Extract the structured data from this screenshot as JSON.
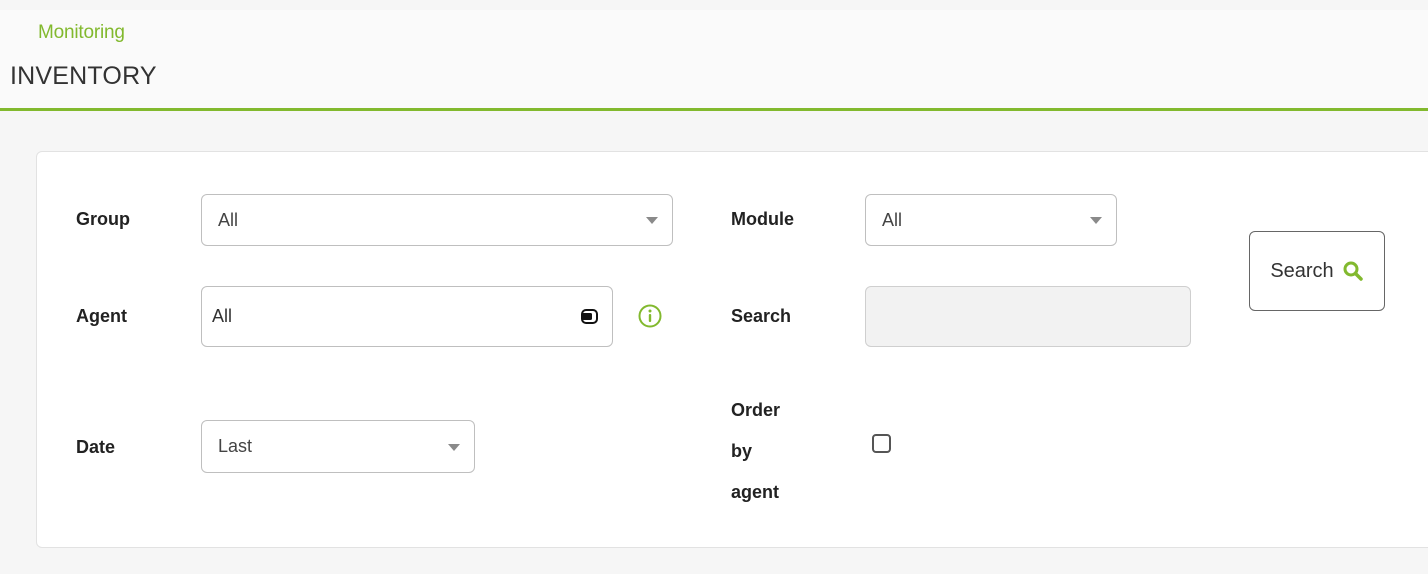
{
  "header": {
    "breadcrumb": "Monitoring",
    "title": "INVENTORY"
  },
  "filters": {
    "group": {
      "label": "Group",
      "value": "All"
    },
    "module": {
      "label": "Module",
      "value": "All"
    },
    "agent": {
      "label": "Agent",
      "value": "All"
    },
    "search": {
      "label": "Search",
      "value": ""
    },
    "date": {
      "label": "Date",
      "value": "Last"
    },
    "order_by_agent": {
      "label_line1": "Order",
      "label_line2": "by",
      "label_line3": "agent",
      "checked": false
    }
  },
  "actions": {
    "search_button_label": "Search"
  },
  "icons": {
    "agent_field": "agent-icon",
    "info": "info-icon",
    "search": "magnifier-icon"
  },
  "colors": {
    "accent": "#82b92e",
    "page_bg": "#f6f6f6",
    "panel_bg": "#ffffff"
  }
}
